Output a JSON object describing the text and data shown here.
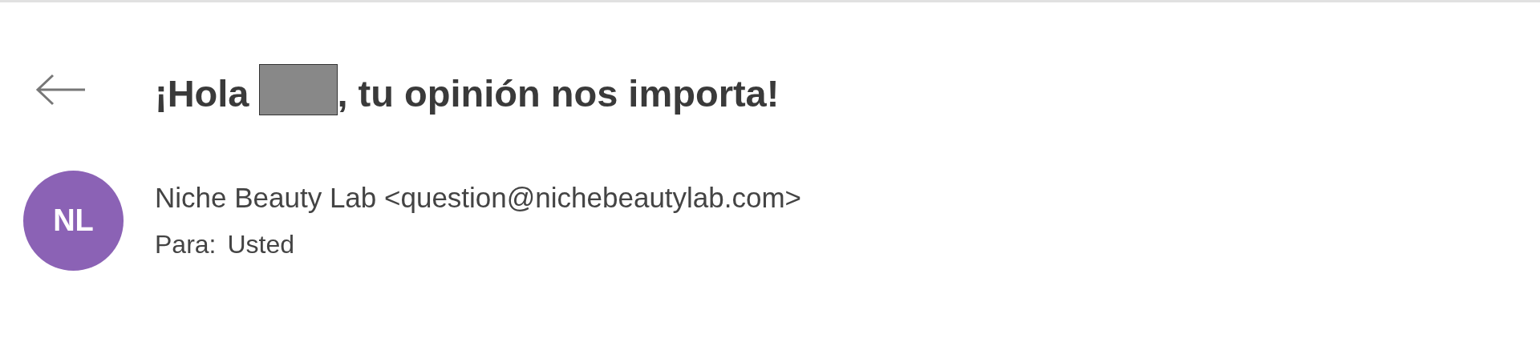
{
  "subject": {
    "before": "¡Hola",
    "after": ", tu opinión nos importa!",
    "redacted": true
  },
  "sender": {
    "initials": "NL",
    "color": "#8b62b5",
    "name": "Niche Beauty Lab",
    "address": "<question@nichebeautylab.com>"
  },
  "recipient": {
    "label": "Para:",
    "value": "Usted"
  }
}
